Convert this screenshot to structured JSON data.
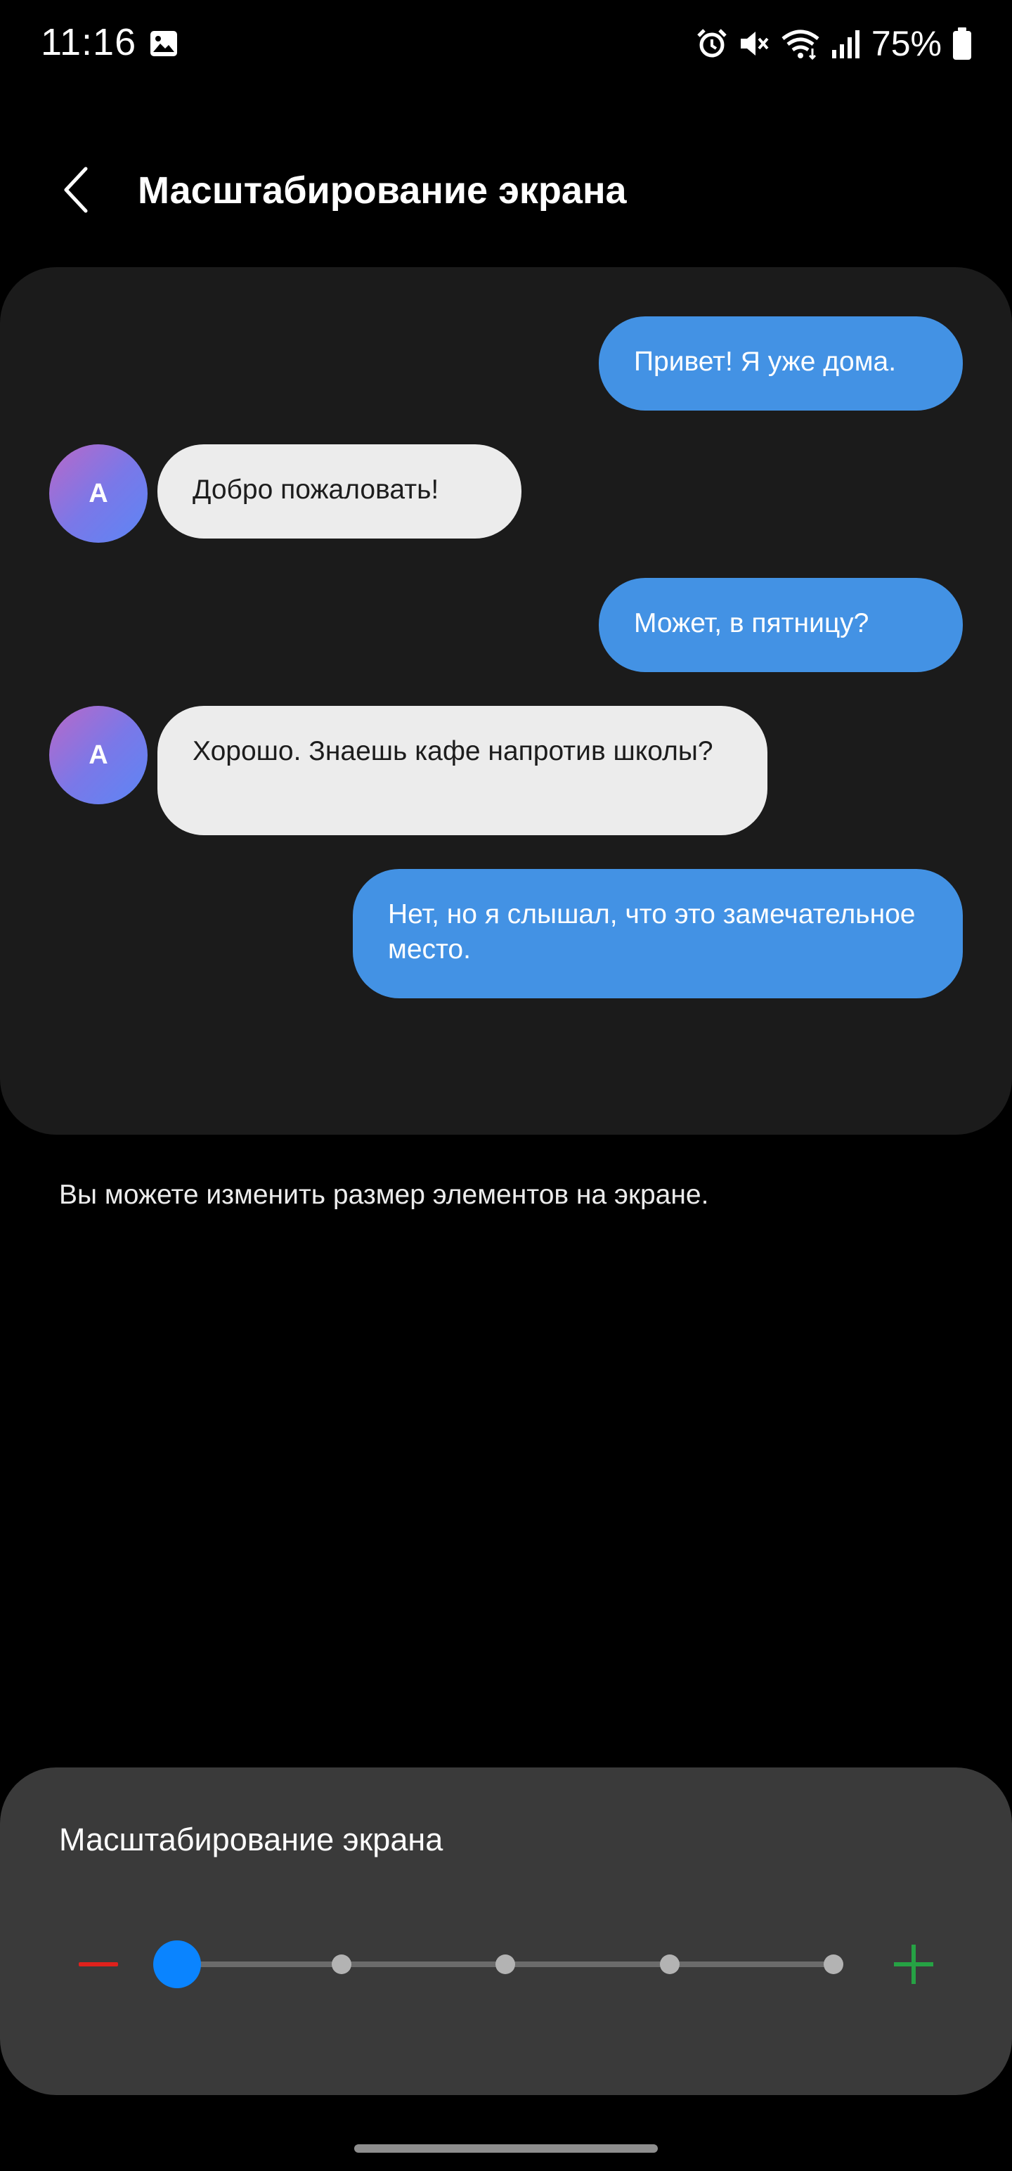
{
  "status_bar": {
    "time": "11:16",
    "battery_percent": "75%",
    "icons": [
      "gallery-icon",
      "alarm-icon",
      "mute-icon",
      "wifi-icon",
      "signal-icon",
      "battery-icon"
    ]
  },
  "header": {
    "back_icon": "chevron-left-icon",
    "title": "Масштабирование экрана"
  },
  "preview": {
    "messages": [
      {
        "direction": "outgoing",
        "text": "Привет! Я уже дома."
      },
      {
        "direction": "incoming",
        "avatar": "A",
        "text": "Добро пожаловать!"
      },
      {
        "direction": "outgoing",
        "text": "Может, в пятницу?"
      },
      {
        "direction": "incoming",
        "avatar": "A",
        "text": "Хорошо. Знаешь кафе напротив школы?"
      },
      {
        "direction": "outgoing",
        "text": "Нет, но я слышал, что это замечательное место."
      }
    ]
  },
  "description": "Вы можете изменить размер элементов на экране.",
  "zoom": {
    "title": "Масштабирование экрана",
    "steps": 5,
    "selected_step": 1,
    "minus_color": "#e0211c",
    "plus_color": "#26a244",
    "thumb_color": "#0a84ff"
  },
  "colors": {
    "background": "#000000",
    "card": "#1b1b1b",
    "panel": "#3a3a3a",
    "outgoing_bubble": "#4392e4",
    "incoming_bubble": "#ececec"
  }
}
